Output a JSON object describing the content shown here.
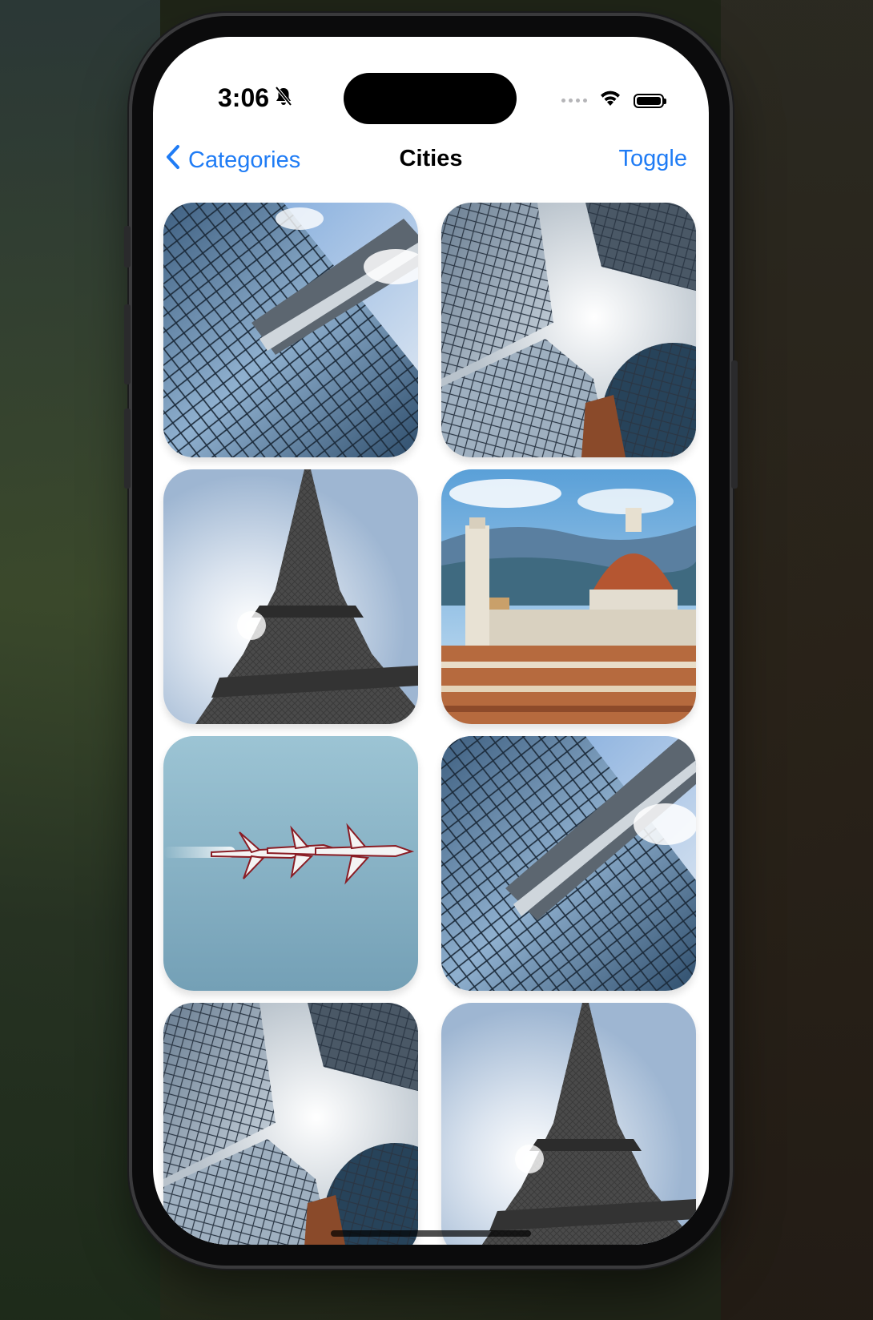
{
  "status_bar": {
    "time": "3:06",
    "mute_icon": "bell-slash-icon",
    "wifi_icon": "wifi-icon",
    "battery_icon": "battery-full-icon"
  },
  "nav": {
    "back_label": "Categories",
    "title": "Cities",
    "action_label": "Toggle"
  },
  "grid": {
    "photos": [
      {
        "subject": "glass skyscraper with skybridge"
      },
      {
        "subject": "looking up between skyscrapers"
      },
      {
        "subject": "Eiffel Tower from below"
      },
      {
        "subject": "Florence cathedral dome"
      },
      {
        "subject": "jets flying in formation"
      },
      {
        "subject": "glass skyscraper with skybridge"
      },
      {
        "subject": "looking up between skyscrapers"
      },
      {
        "subject": "Eiffel Tower from below"
      }
    ]
  },
  "colors": {
    "accent": "#1f7cf5",
    "screen_background": "#ffffff"
  }
}
